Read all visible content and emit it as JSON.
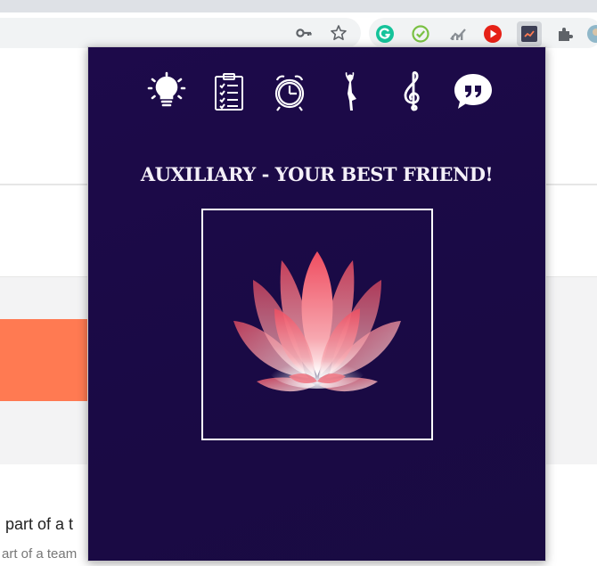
{
  "browser": {
    "address_bar_icons": [
      "key-icon",
      "star-icon"
    ],
    "extensions": [
      "grammarly-icon",
      "check-circle-icon",
      "chart-icon",
      "play-icon",
      "auxiliary-extension-icon",
      "puzzle-icon",
      "profile-avatar-icon"
    ]
  },
  "background_page": {
    "heading": "part of a t",
    "subtext": "art of a team"
  },
  "popup": {
    "nav_icons": [
      "lightbulb-icon",
      "clipboard-checklist-icon",
      "alarm-clock-icon",
      "yoga-pose-icon",
      "treble-clef-icon",
      "quote-bubble-icon"
    ],
    "title": "AUXILIARY - YOUR BEST FRIEND!",
    "image_name": "lotus-image"
  },
  "colors": {
    "popup_bg": "#1d0a4a",
    "icon_white": "#ffffff",
    "lotus_pink": "#f25b6b",
    "accent_orange": "#ff7a52"
  }
}
